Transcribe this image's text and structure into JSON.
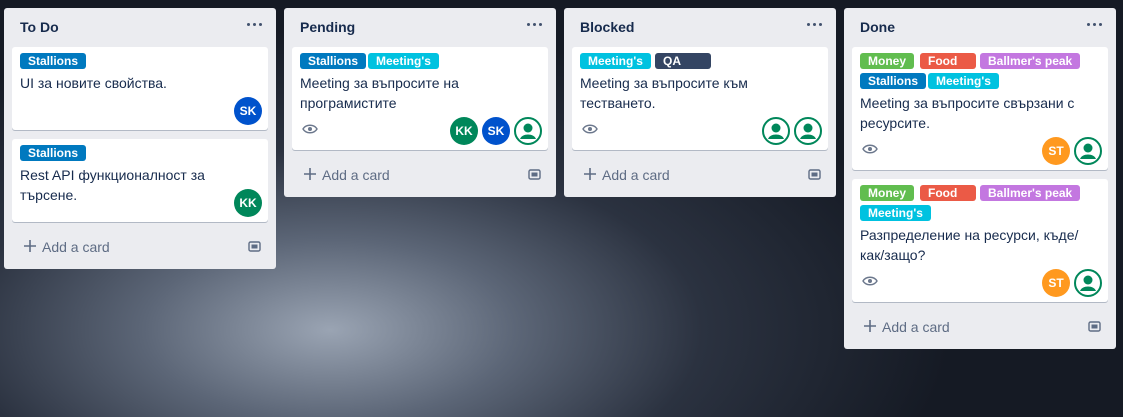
{
  "colors": {
    "green": "#61bd4f",
    "red": "#eb5a46",
    "purple": "#c377e0",
    "blue": "#0079bf",
    "sky": "#00c2e0",
    "navy": "#344563",
    "avatar_sk": "#0052cc",
    "avatar_kk": "#00875a",
    "avatar_st": "#ff991f",
    "avatar_default": "#00875a"
  },
  "lists": [
    {
      "title": "To Do",
      "add_card": "Add a card",
      "cards": [
        {
          "labels": [
            "Stallions"
          ],
          "title": "UI за новите свойства.",
          "members": [
            "SK"
          ]
        },
        {
          "labels": [
            "Stallions"
          ],
          "title": "Rest API функционалност за търсене.",
          "members": [
            "KK"
          ]
        }
      ]
    },
    {
      "title": "Pending",
      "add_card": "Add a card",
      "cards": [
        {
          "labels": [
            "Stallions",
            "Meeting's"
          ],
          "title": "Meeting за въпросите на програмистите",
          "members": [
            "KK",
            "SK",
            "default-avatar"
          ],
          "watching": true
        }
      ]
    },
    {
      "title": "Blocked",
      "add_card": "Add a card",
      "cards": [
        {
          "labels": [
            "Meeting's",
            "QA"
          ],
          "title": "Meeting за въпросите към тестването.",
          "members": [
            "default-avatar",
            "default-avatar"
          ],
          "watching": true
        }
      ]
    },
    {
      "title": "Done",
      "add_card": "Add a card",
      "cards": [
        {
          "labels": [
            "Money",
            "Food",
            "Ballmer's peak",
            "Stallions",
            "Meeting's"
          ],
          "title": "Meeting за въпросите свързани с ресурсите.",
          "members": [
            "ST",
            "default-avatar"
          ],
          "watching": true
        },
        {
          "labels": [
            "Money",
            "Food",
            "Ballmer's peak",
            "Meeting's"
          ],
          "title": "Разпределение на ресурси, къде/как/защо?",
          "members": [
            "ST",
            "default-avatar"
          ],
          "watching": true
        }
      ]
    }
  ]
}
